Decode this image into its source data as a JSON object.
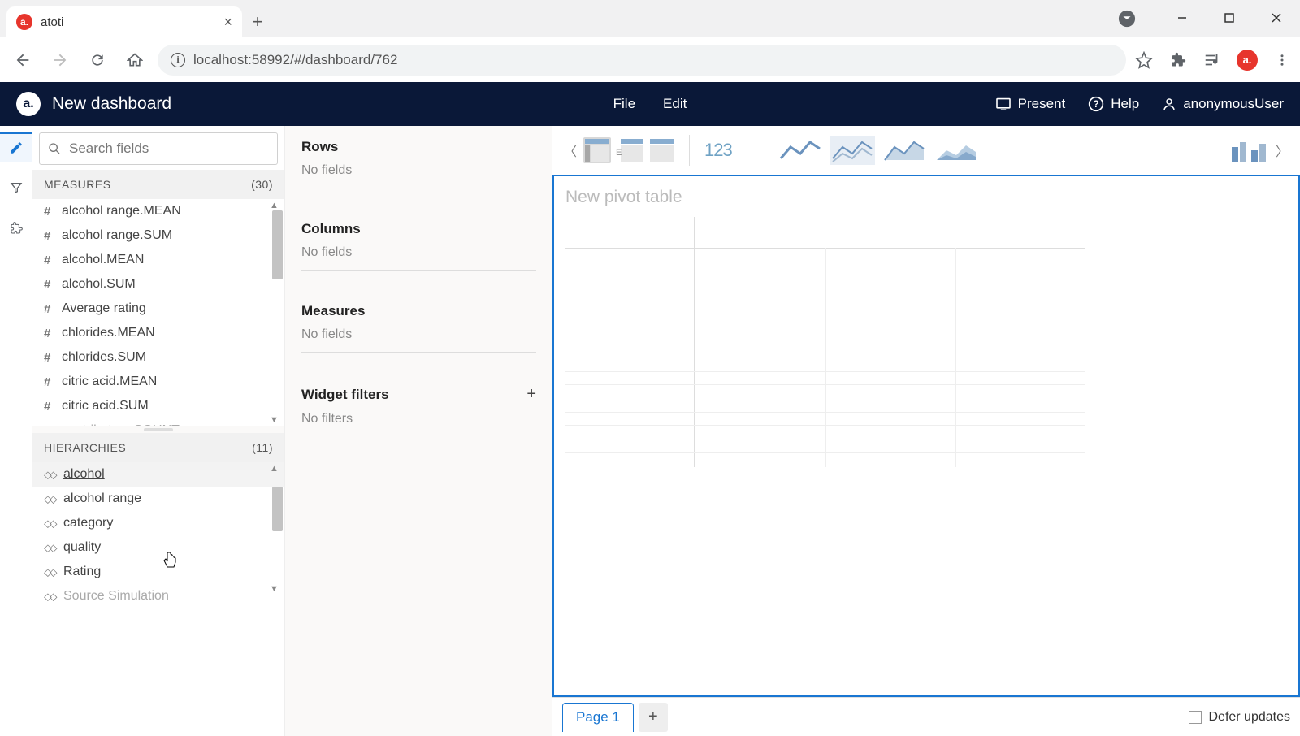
{
  "browser": {
    "tab_title": "atoti",
    "url": "localhost:58992/#/dashboard/762"
  },
  "header": {
    "dashboard_title": "New dashboard",
    "menu": {
      "file": "File",
      "edit": "Edit"
    },
    "present": "Present",
    "help": "Help",
    "user": "anonymousUser"
  },
  "fields_panel": {
    "search_placeholder": "Search fields",
    "measures_label": "MEASURES",
    "measures_count": "(30)",
    "measures": [
      "alcohol range.MEAN",
      "alcohol range.SUM",
      "alcohol.MEAN",
      "alcohol.SUM",
      "Average rating",
      "chlorides.MEAN",
      "chlorides.SUM",
      "citric acid.MEAN",
      "citric acid.SUM",
      "contributors.COUNT"
    ],
    "hierarchies_label": "HIERARCHIES",
    "hierarchies_count": "(11)",
    "hierarchies": [
      "alcohol",
      "alcohol range",
      "category",
      "quality",
      "Rating",
      "Source Simulation"
    ]
  },
  "config_panel": {
    "rows": {
      "label": "Rows",
      "empty": "No fields"
    },
    "columns": {
      "label": "Columns",
      "empty": "No fields"
    },
    "measures": {
      "label": "Measures",
      "empty": "No fields"
    },
    "widget_filters": {
      "label": "Widget filters",
      "empty": "No filters"
    }
  },
  "canvas": {
    "pivot_title": "New pivot table",
    "num_label": "123"
  },
  "bottom": {
    "page1": "Page 1",
    "defer": "Defer updates"
  }
}
